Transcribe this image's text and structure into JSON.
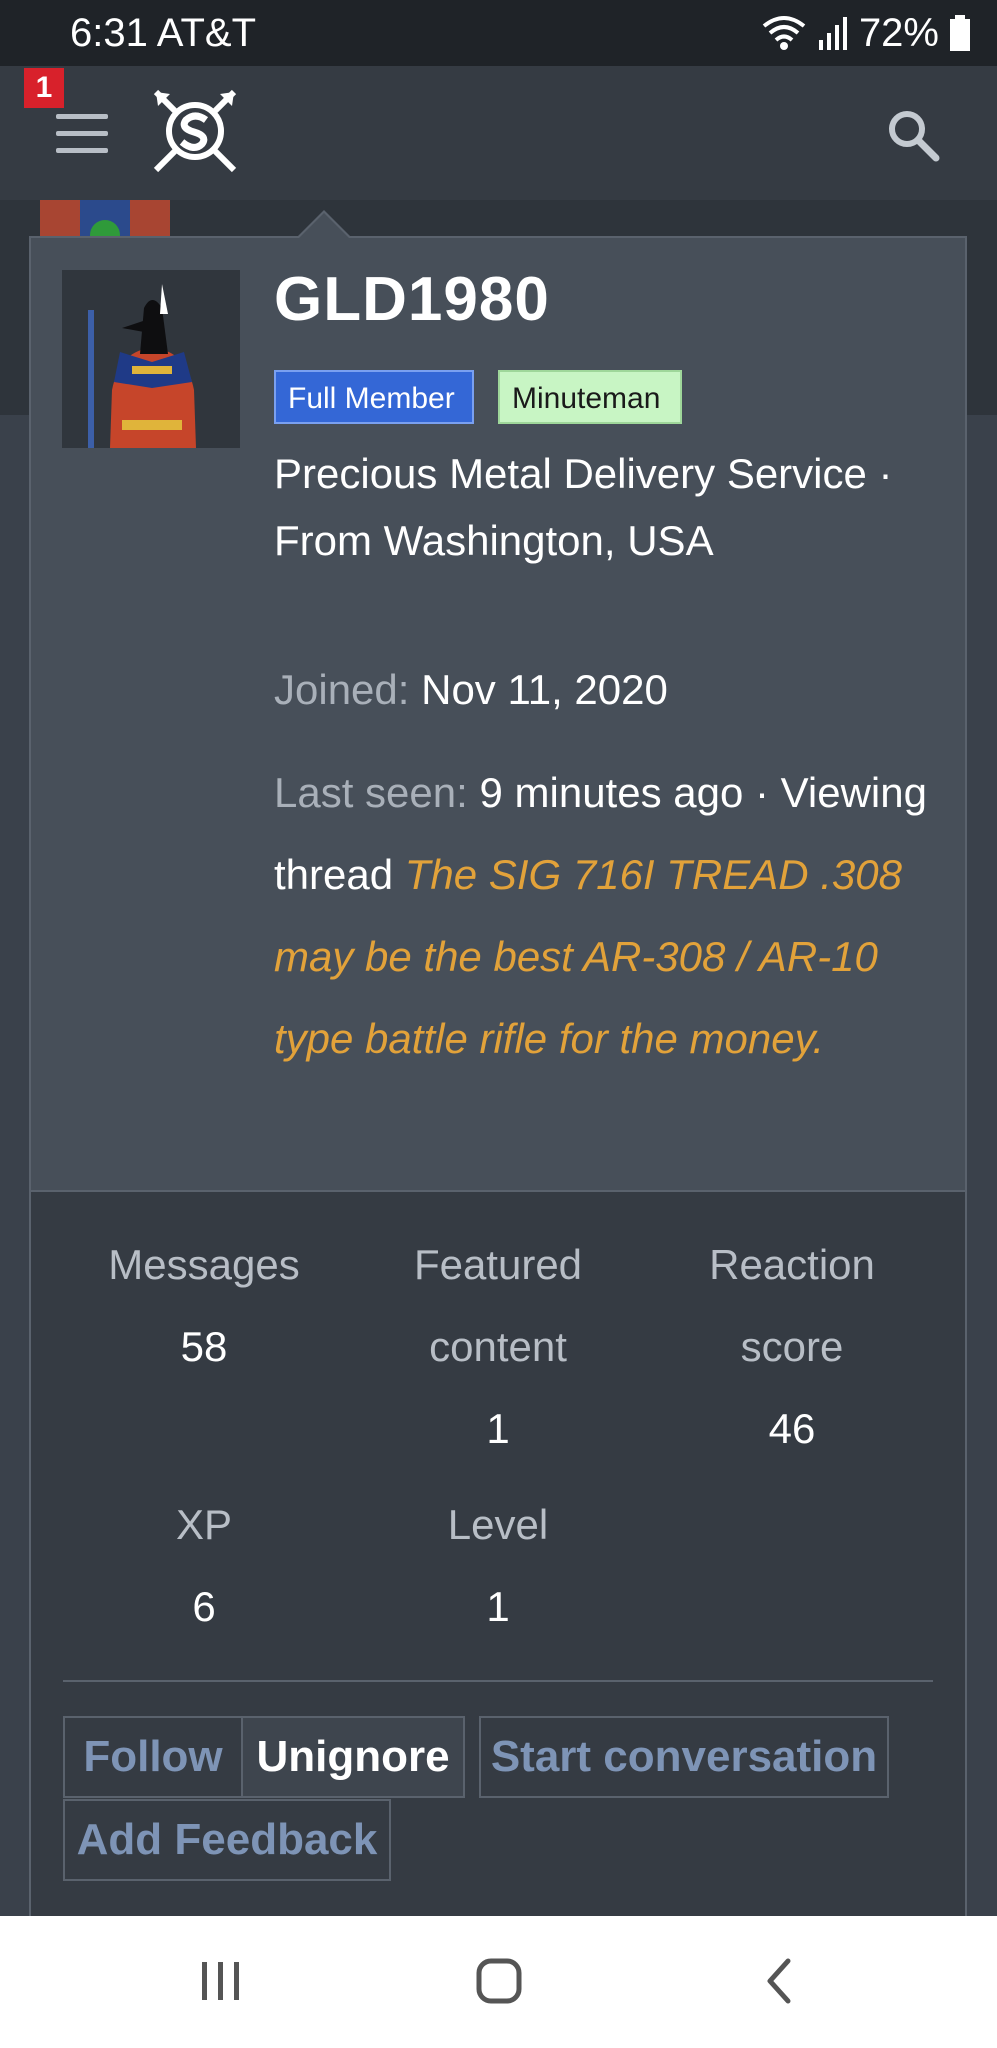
{
  "status_bar": {
    "time_carrier": "6:31 AT&T",
    "battery_percent": "72%",
    "icons": [
      "wifi-icon",
      "signal-icon",
      "battery-icon"
    ]
  },
  "header": {
    "notification_count": "1",
    "icons": [
      "hamburger-menu-icon",
      "site-logo",
      "search-icon"
    ]
  },
  "profile": {
    "username": "GLD1980",
    "tags": [
      "Full Member",
      "Minuteman"
    ],
    "user_title": "Precious Metal Delivery Service · From Washington, USA",
    "joined_label": "Joined:",
    "joined_value": "Nov 11, 2020",
    "last_seen_label": "Last seen:",
    "last_seen_value": "9 minutes ago ·",
    "activity_text": "Viewing thread",
    "thread_title": "The SIG 716I TREAD .308 may be the best AR-308 / AR-10 type battle rifle for the money."
  },
  "stats": [
    {
      "label": "Messages",
      "value": "58"
    },
    {
      "label": "Featured content",
      "value": "1"
    },
    {
      "label": "Reaction score",
      "value": "46"
    },
    {
      "label": "XP",
      "value": "6"
    },
    {
      "label": "Level",
      "value": "1"
    }
  ],
  "actions": {
    "follow": "Follow",
    "unignore": "Unignore",
    "start_conversation": "Start conversation",
    "add_feedback": "Add Feedback"
  },
  "colors": {
    "tag_full_member": "#3467d6",
    "tag_minuteman": "#c8f5c4",
    "thread_link": "#e2a23a",
    "badge": "#d8212b"
  }
}
